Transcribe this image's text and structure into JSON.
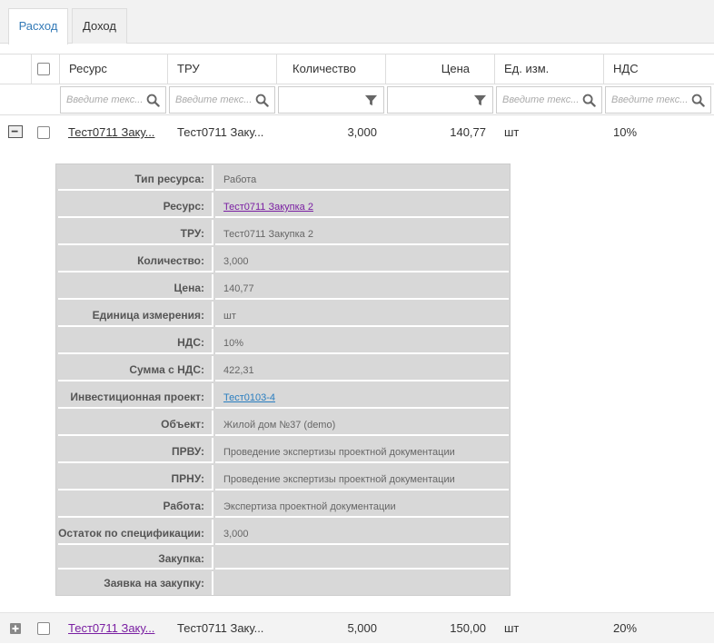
{
  "tabs": [
    {
      "label": "Расход",
      "active": true
    },
    {
      "label": "Доход",
      "active": false
    }
  ],
  "columns": {
    "resource": "Ресурс",
    "tru": "ТРУ",
    "qty": "Количество",
    "price": "Цена",
    "unit": "Ед. изм.",
    "vat": "НДС"
  },
  "filters": {
    "placeholder": "Введите текс..."
  },
  "rows": [
    {
      "resource": "Тест0711 Заку...",
      "tru": "Тест0711 Заку...",
      "qty": "3,000",
      "price": "140,77",
      "unit": "шт",
      "vat": "10%"
    },
    {
      "resource": "Тест0711 Заку...",
      "tru": "Тест0711 Заку...",
      "qty": "5,000",
      "price": "150,00",
      "unit": "шт",
      "vat": "20%"
    }
  ],
  "detail": [
    {
      "label": "Тип ресурса:",
      "value": "Работа"
    },
    {
      "label": "Ресурс:",
      "value": "Тест0711 Закупка 2"
    },
    {
      "label": "ТРУ:",
      "value": "Тест0711 Закупка 2"
    },
    {
      "label": "Количество:",
      "value": "3,000"
    },
    {
      "label": "Цена:",
      "value": "140,77"
    },
    {
      "label": "Единица измерения:",
      "value": "шт"
    },
    {
      "label": "НДС:",
      "value": "10%"
    },
    {
      "label": "Сумма с НДС:",
      "value": "422,31"
    },
    {
      "label": "Инвестиционная проект:",
      "value": "Тест0103-4"
    },
    {
      "label": "Объект:",
      "value": "Жилой дом №37 (demo)"
    },
    {
      "label": "ПРВУ:",
      "value": "Проведение экспертизы проектной документации"
    },
    {
      "label": "ПРНУ:",
      "value": "Проведение экспертизы проектной документации"
    },
    {
      "label": "Работа:",
      "value": "Экспертиза проектной документации"
    },
    {
      "label": "Остаток по спецификации:",
      "value": "3,000"
    },
    {
      "label": "Закупка:",
      "value": ""
    },
    {
      "label": "Заявка на закупку:",
      "value": ""
    }
  ]
}
